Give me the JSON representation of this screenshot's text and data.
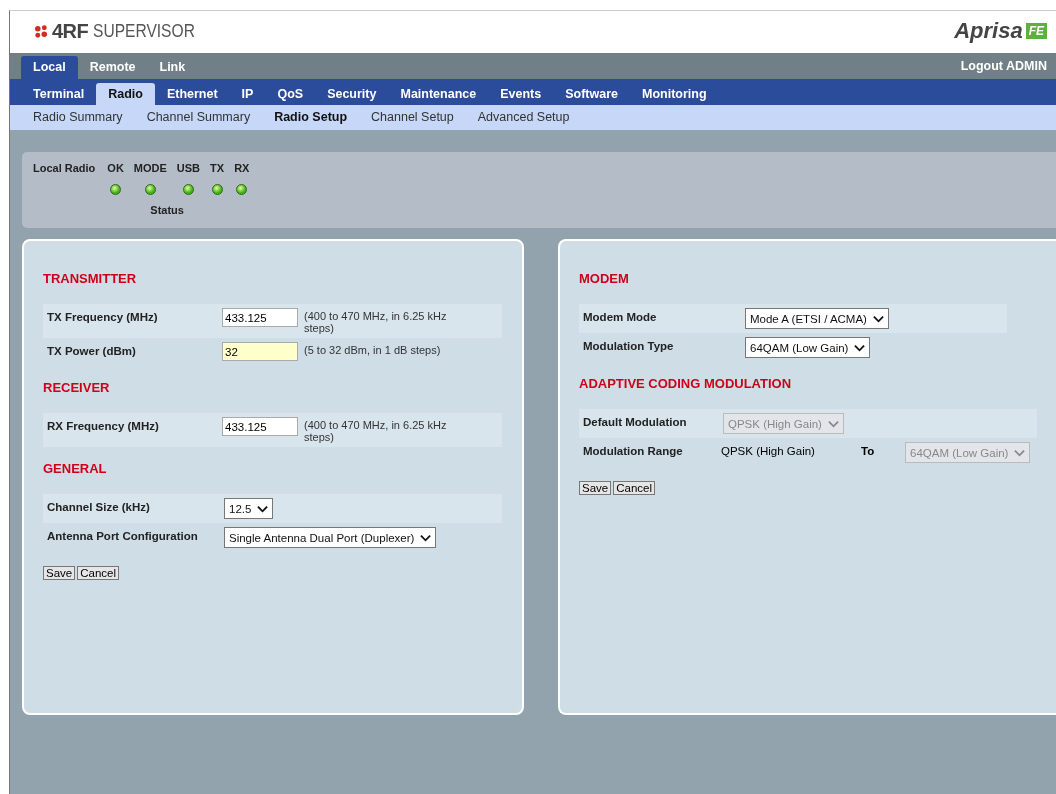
{
  "header": {
    "logo_mark": "4RF",
    "logo_text": "SUPERVISOR",
    "brand": "Aprisa",
    "brand_badge": "FE"
  },
  "top_tabs": [
    {
      "label": "Local",
      "selected": true
    },
    {
      "label": "Remote",
      "selected": false
    },
    {
      "label": "Link",
      "selected": false
    }
  ],
  "logout": "Logout ADMIN",
  "nav": [
    {
      "label": "Terminal",
      "selected": false
    },
    {
      "label": "Radio",
      "selected": true
    },
    {
      "label": "Ethernet",
      "selected": false
    },
    {
      "label": "IP",
      "selected": false
    },
    {
      "label": "QoS",
      "selected": false
    },
    {
      "label": "Security",
      "selected": false
    },
    {
      "label": "Maintenance",
      "selected": false
    },
    {
      "label": "Events",
      "selected": false
    },
    {
      "label": "Software",
      "selected": false
    },
    {
      "label": "Monitoring",
      "selected": false
    }
  ],
  "subnav": [
    {
      "label": "Radio Summary",
      "selected": false
    },
    {
      "label": "Channel Summary",
      "selected": false
    },
    {
      "label": "Radio Setup",
      "selected": true
    },
    {
      "label": "Channel Setup",
      "selected": false
    },
    {
      "label": "Advanced Setup",
      "selected": false
    }
  ],
  "status": {
    "label": "Local Radio",
    "caption": "Status",
    "leds": [
      {
        "label": "OK",
        "on": true
      },
      {
        "label": "MODE",
        "on": true
      },
      {
        "label": "USB",
        "on": true
      },
      {
        "label": "TX",
        "on": true
      },
      {
        "label": "RX",
        "on": true
      }
    ]
  },
  "panels": [
    {
      "sections": [
        {
          "title": "TRANSMITTER",
          "rows": [
            {
              "kind": "input",
              "label": "TX Frequency (MHz)",
              "value": "433.125",
              "highlighted": false,
              "hint": "(400 to 470 MHz, in 6.25 kHz steps)"
            },
            {
              "kind": "input",
              "label": "TX Power (dBm)",
              "value": "32",
              "highlighted": true,
              "hint": "(5 to 32 dBm, in 1 dB steps)"
            }
          ]
        },
        {
          "title": "RECEIVER",
          "rows": [
            {
              "kind": "input",
              "label": "RX Frequency (MHz)",
              "value": "433.125",
              "highlighted": false,
              "hint": "(400 to 470 MHz, in 6.25 kHz steps)"
            }
          ]
        },
        {
          "title": "GENERAL",
          "rows": [
            {
              "kind": "select",
              "label": "Channel Size (kHz)",
              "value": "12.5",
              "disabled": false
            },
            {
              "kind": "select",
              "label": "Antenna Port Configuration",
              "value": "Single Antenna Dual Port (Duplexer)",
              "disabled": false
            }
          ]
        }
      ],
      "buttons": [
        "Save",
        "Cancel"
      ]
    },
    {
      "sections": [
        {
          "title": "MODEM",
          "rows": [
            {
              "kind": "select",
              "label": "Modem Mode",
              "value": "Mode A (ETSI / ACMA)",
              "disabled": false
            },
            {
              "kind": "select",
              "label": "Modulation Type",
              "value": "64QAM (Low Gain)",
              "disabled": false
            }
          ]
        },
        {
          "title": "ADAPTIVE CODING MODULATION",
          "rows": [
            {
              "kind": "select",
              "label": "Default Modulation",
              "value": "QPSK (High Gain)",
              "disabled": true
            },
            {
              "kind": "range",
              "label": "Modulation Range",
              "from": "QPSK (High Gain)",
              "to_label": "To",
              "value": "64QAM (Low Gain)",
              "disabled": true
            }
          ]
        }
      ],
      "buttons": [
        "Save",
        "Cancel"
      ]
    }
  ]
}
